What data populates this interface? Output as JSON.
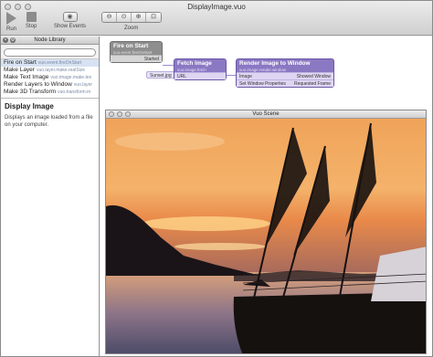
{
  "window": {
    "title": "DisplayImage.vuo"
  },
  "toolbar": {
    "run_label": "Run",
    "stop_label": "Stop",
    "show_events_label": "Show Events",
    "zoom_label": "Zoom",
    "zoom_buttons": [
      "⊖",
      "⊙",
      "⊕",
      "⊡"
    ]
  },
  "library": {
    "header": "Node Library",
    "search_value": "",
    "items": [
      {
        "label": "Fire on Start",
        "sub": "vuo.event.fireOnStart"
      },
      {
        "label": "Make Layer",
        "sub": "vuo.layer.make.realSize"
      },
      {
        "label": "Make Text Image",
        "sub": "vuo.image.make.tex"
      },
      {
        "label": "Render Layers to Window",
        "sub": "vuo.layer"
      },
      {
        "label": "Make 3D Transform",
        "sub": "vuo.transform.m"
      }
    ],
    "desc_title": "Display Image",
    "desc_text": "Displays an image loaded from a file on your computer."
  },
  "nodes": {
    "fire": {
      "title": "Fire on Start",
      "sub": "vuo.event.fireOnStart",
      "port": "Started"
    },
    "fetch": {
      "title": "Fetch Image",
      "sub": "vuo.image.fetch",
      "port": "URL",
      "input": "Sunset.jpg"
    },
    "render": {
      "title": "Render Image to Window",
      "sub": "vuo.image.render.window",
      "port_image": "Image",
      "port_props": "Set Window Properties",
      "out_shown": "Showed Window",
      "out_frame": "Requested Frame"
    }
  },
  "scene": {
    "title": "Vuo Scene"
  },
  "colors": {
    "node_purple": "#8b78c3",
    "node_gray": "#8e8e8e"
  }
}
